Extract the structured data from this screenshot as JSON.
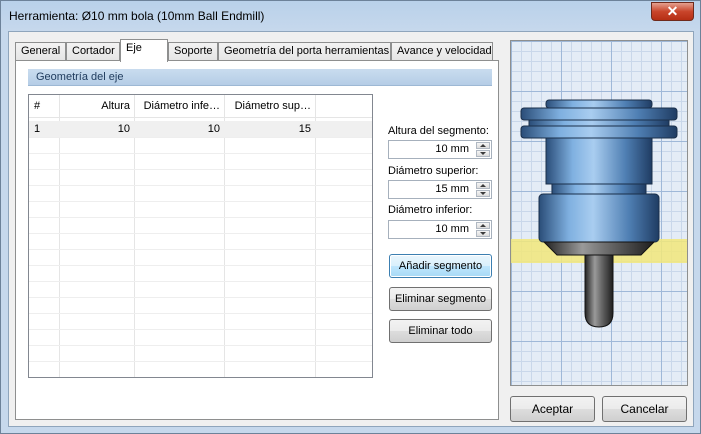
{
  "window": {
    "title": "Herramienta: Ø10 mm bola (10mm Ball Endmill)",
    "close_label": "✕"
  },
  "tabs": [
    {
      "label": "General",
      "active": false
    },
    {
      "label": "Cortador",
      "active": false
    },
    {
      "label": "Eje",
      "active": true
    },
    {
      "label": "Soporte",
      "active": false
    },
    {
      "label": "Geometría del porta herramientas",
      "active": false
    },
    {
      "label": "Avance y velocidad",
      "active": false
    }
  ],
  "group": {
    "title": "Geometría del eje"
  },
  "table": {
    "columns": [
      "#",
      "Altura",
      "Diámetro infe…",
      "Diámetro sup…"
    ],
    "rows": [
      {
        "index": "1",
        "altura": "10",
        "diam_inf": "10",
        "diam_sup": "15"
      }
    ]
  },
  "fields": {
    "altura": {
      "label": "Altura del segmento:",
      "value": "10 mm"
    },
    "diam_sup": {
      "label": "Diámetro superior:",
      "value": "15 mm"
    },
    "diam_inf": {
      "label": "Diámetro inferior:",
      "value": "10 mm"
    }
  },
  "buttons": {
    "add": "Añadir segmento",
    "remove": "Eliminar segmento",
    "remove_all": "Eliminar todo",
    "ok": "Aceptar",
    "cancel": "Cancelar"
  },
  "colors": {
    "highlight_band": "#f2e77a",
    "holder": "#6a9ccc"
  }
}
